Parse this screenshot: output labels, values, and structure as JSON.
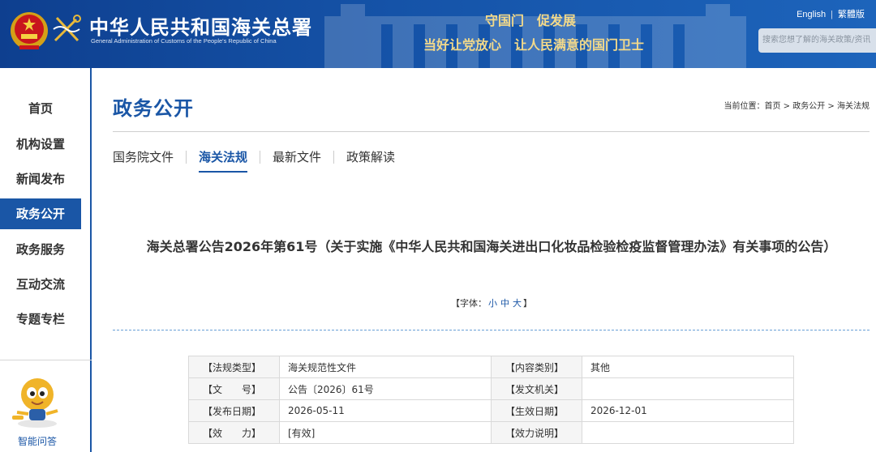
{
  "header": {
    "site_title": "中华人民共和国海关总署",
    "site_subtitle": "General Administration of Customs of the People's Republic of China",
    "slogan_line1": "守国门　促发展",
    "slogan_line2": "当好让党放心　让人民满意的国门卫士",
    "lang_english": "English",
    "lang_traditional": "繁體版",
    "search_placeholder": "搜索您想了解的海关政策/资讯",
    "brand_color": "#1a56a6"
  },
  "sidebar": {
    "items": [
      {
        "label": "首页"
      },
      {
        "label": "机构设置"
      },
      {
        "label": "新闻发布"
      },
      {
        "label": "政务公开",
        "active": true
      },
      {
        "label": "政务服务"
      },
      {
        "label": "互动交流"
      },
      {
        "label": "专题专栏"
      }
    ],
    "assistant_label": "智能问答"
  },
  "main": {
    "page_title": "政务公开",
    "breadcrumb": {
      "prefix": "当前位置：",
      "items": [
        "首页",
        "政务公开",
        "海关法规"
      ],
      "sep": " > "
    },
    "tabs": [
      {
        "label": "国务院文件"
      },
      {
        "label": "海关法规",
        "active": true
      },
      {
        "label": "最新文件"
      },
      {
        "label": "政策解读"
      }
    ],
    "doc_title": "海关总署公告2026年第61号（关于实施《中华人民共和国海关进出口化妆品检验检疫监督管理办法》有关事项的公告）",
    "font_size_control": {
      "open": "【字体：",
      "small": "小",
      "medium": "中",
      "large": "大",
      "close": "】"
    },
    "meta_table": [
      {
        "label": "【法规类型】",
        "value": "海关规范性文件",
        "label2": "【内容类别】",
        "value2": "其他"
      },
      {
        "label": "【文　　号】",
        "value": "公告〔2026〕61号",
        "label2": "【发文机关】",
        "value2": ""
      },
      {
        "label": "【发布日期】",
        "value": "2026-05-11",
        "label2": "【生效日期】",
        "value2": "2026-12-01"
      },
      {
        "label": "【效　　力】",
        "value": "[有效]",
        "label2": "【效力说明】",
        "value2": ""
      }
    ]
  }
}
